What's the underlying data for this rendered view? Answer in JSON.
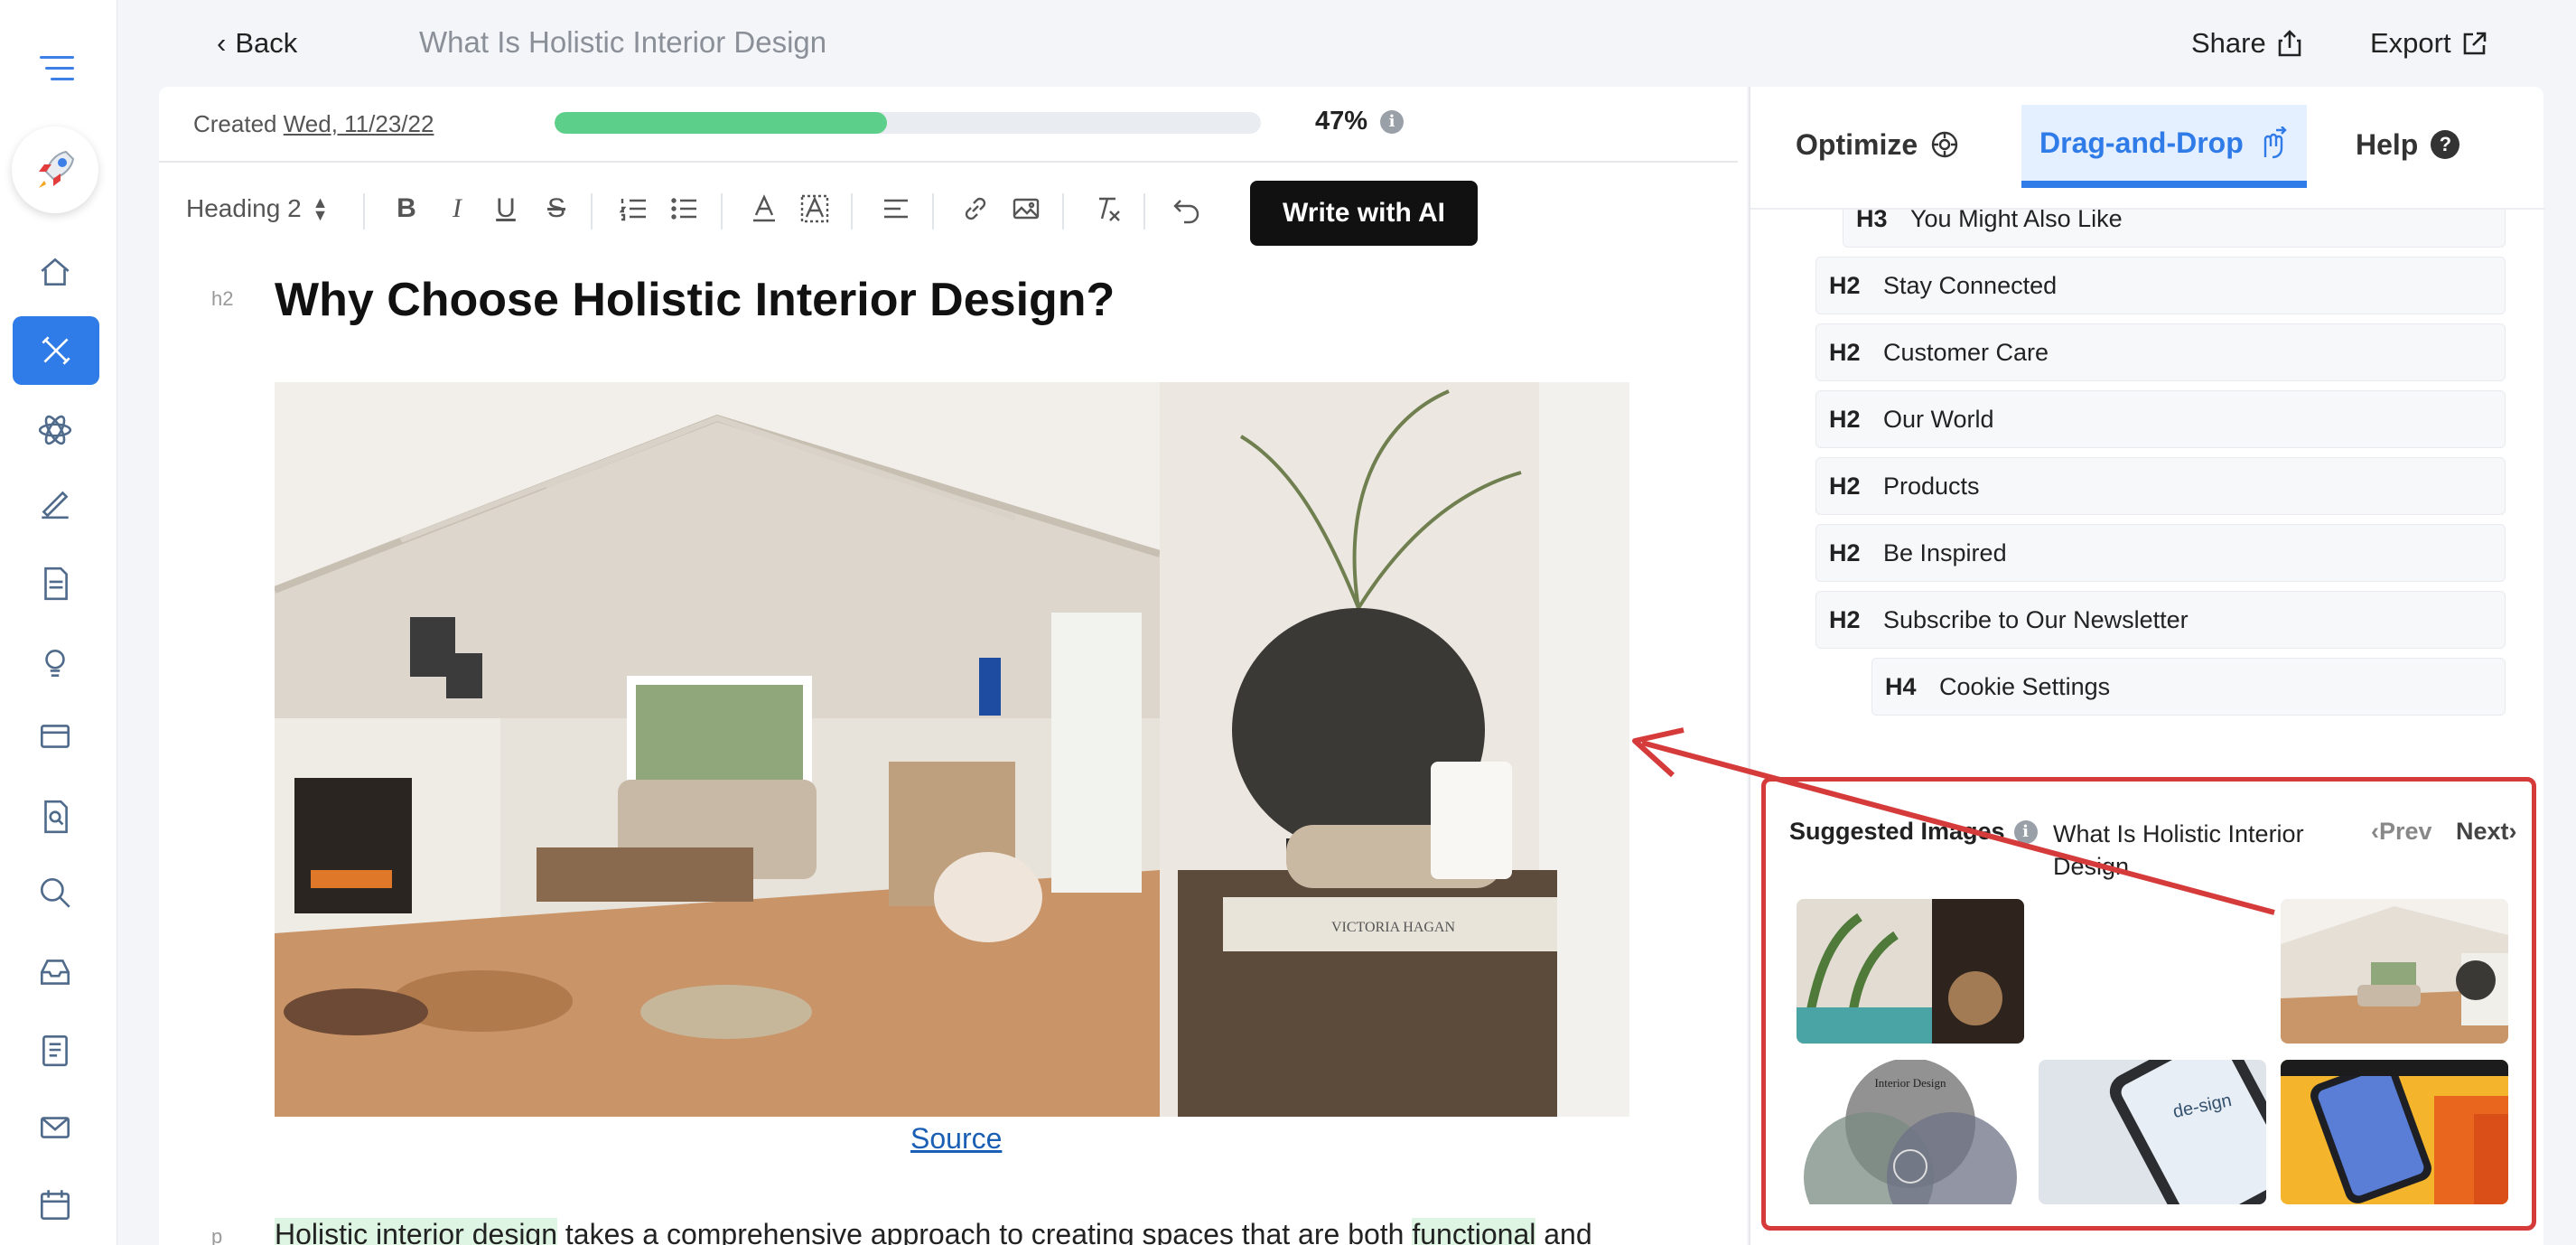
{
  "topbar": {
    "back_label": "Back",
    "doc_title": "What Is Holistic Interior Design",
    "share_label": "Share",
    "export_label": "Export"
  },
  "meta": {
    "created_prefix": "Created",
    "created_date": "Wed, 11/23/22",
    "progress_percent": 47,
    "progress_label": "47%"
  },
  "toolbar": {
    "heading_select": "Heading 2",
    "ai_button": "Write with AI"
  },
  "content": {
    "h2_tag": "h2",
    "heading": "Why Choose Holistic Interior Design?",
    "source_link": "Source",
    "p_tag": "p",
    "para_hl1": "Holistic interior design",
    "para_mid": " takes a comprehensive approach to creating spaces that are both ",
    "para_hl2": "functional",
    "para_end": " and"
  },
  "sidebar_tabs": {
    "optimize": "Optimize",
    "dragdrop": "Drag-and-Drop",
    "help": "Help"
  },
  "headings": [
    {
      "level": "H3",
      "text": "You Might Also Like"
    },
    {
      "level": "H2",
      "text": "Stay Connected"
    },
    {
      "level": "H2",
      "text": "Customer Care"
    },
    {
      "level": "H2",
      "text": "Our World"
    },
    {
      "level": "H2",
      "text": "Products"
    },
    {
      "level": "H2",
      "text": "Be Inspired"
    },
    {
      "level": "H2",
      "text": "Subscribe to Our Newsletter"
    },
    {
      "level": "H4",
      "text": "Cookie Settings"
    }
  ],
  "suggested": {
    "title": "Suggested Images",
    "query": "What Is Holistic Interior Design",
    "prev": "Prev",
    "next": "Next",
    "venn_title": "Interior Design",
    "phone_text": "de-sign"
  },
  "colors": {
    "accent": "#2f7be8",
    "progress": "#5ccf8a",
    "highlight_box": "#d63b3b"
  }
}
